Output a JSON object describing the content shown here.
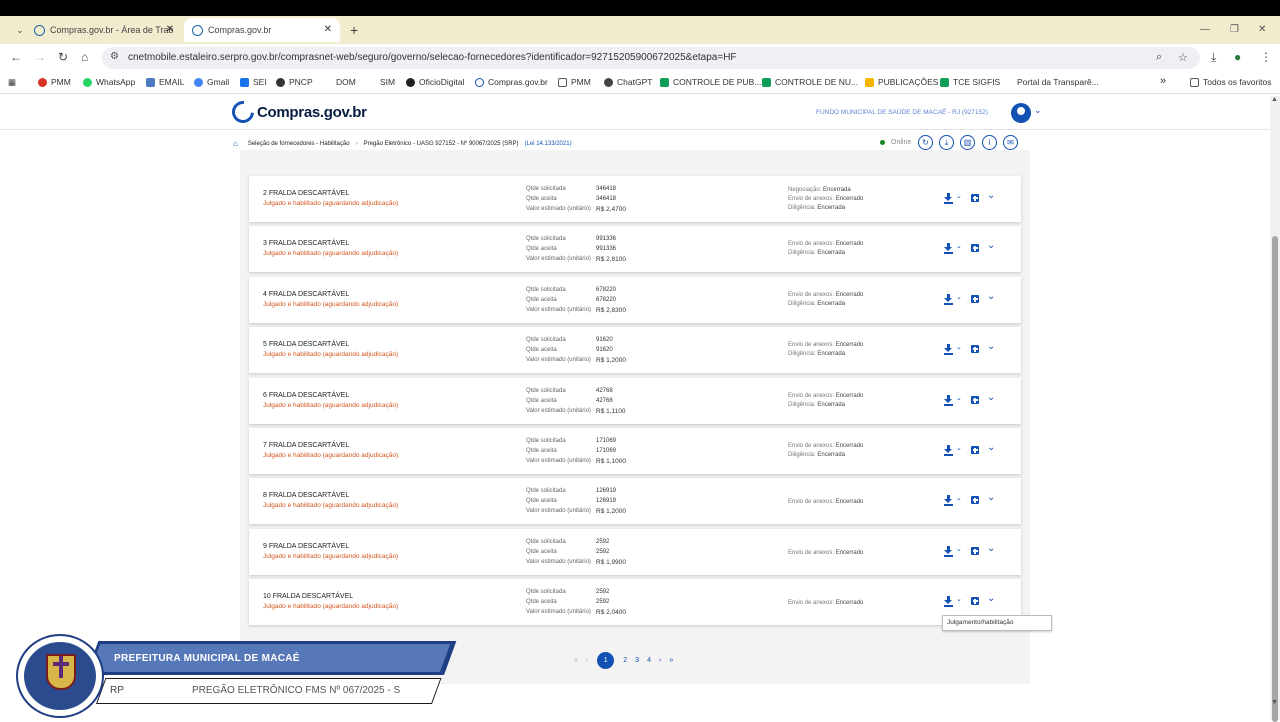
{
  "browser": {
    "tabs": [
      {
        "label": "Compras.gov.br - Área de Trab"
      },
      {
        "label": "Compras.gov.br"
      }
    ],
    "new_tab": "+",
    "url": "cnetmobile.estaleiro.serpro.gov.br/comprasnet-web/seguro/governo/selecao-fornecedores?identificador=92715205900672025&etapa=HF",
    "bookmarks": [
      {
        "label": "PMM",
        "color": "#d93025"
      },
      {
        "label": "WhatsApp",
        "color": "#25d366"
      },
      {
        "label": "EMAIL",
        "color": "#4a7ac0"
      },
      {
        "label": "Gmail",
        "color": "#4285f4"
      },
      {
        "label": "SEI",
        "color": "#1a73e8"
      },
      {
        "label": "PNCP",
        "color": "#333333"
      },
      {
        "label": "DOM",
        "color": "#ffffff"
      },
      {
        "label": "SIM",
        "color": "#ffffff"
      },
      {
        "label": "OficioDigital",
        "color": "#222222"
      },
      {
        "label": "Compras.gov.br",
        "color": "#1351b4"
      },
      {
        "label": "PMM",
        "color": "#555555"
      },
      {
        "label": "ChatGPT",
        "color": "#444444"
      },
      {
        "label": "CONTROLE DE PUB...",
        "color": "#0f9d58"
      },
      {
        "label": "CONTROLE DE NU...",
        "color": "#0f9d58"
      },
      {
        "label": "PUBLICAÇÕES",
        "color": "#f4b400"
      },
      {
        "label": "TCE SIGFIS",
        "color": "#0f9d58"
      },
      {
        "label": "Portal da Transparê...",
        "color": "#ffffff"
      }
    ],
    "more_bookmarks": "»",
    "all_favorites": "Todos os favoritos"
  },
  "header": {
    "logo_text": "Compras.gov.br",
    "org": "FUNDO MUNICIPAL DE SAÚDE DE MACAÉ - RJ (927152)"
  },
  "breadcrumb": {
    "items": [
      "Seleção de fornecedores - Habilitação",
      "Pregão Eletrônico - UASG 927152 - Nº 90067/2025 (SRP)"
    ],
    "lei": "(Lei 14.133/2021)"
  },
  "status": {
    "online": "Online"
  },
  "labels": {
    "qtde_solicitada": "Qtde solicitada",
    "qtde_aceita": "Qtde aceita",
    "valor_estimado": "Valor estimado (unitário)",
    "negociacao": "Negociação:",
    "envio_anexos": "Envio de anexos:",
    "diligencia": "Diligência:"
  },
  "items": [
    {
      "title": "2  FRALDA DESCARTÁVEL",
      "status": "Julgado e habilitado (aguardando adjudicação)",
      "qtde_solicitada": "346418",
      "qtde_aceita": "346418",
      "valor": "R$ 2,4700",
      "negociacao": "Encerrada",
      "envio": "Encerrado",
      "diligencia": "Encerrada"
    },
    {
      "title": "3  FRALDA DESCARTÁVEL",
      "status": "Julgado e habilitado (aguardando adjudicação)",
      "qtde_solicitada": "991336",
      "qtde_aceita": "991336",
      "valor": "R$ 2,8100",
      "negociacao": "",
      "envio": "Encerrado",
      "diligencia": "Encerrada"
    },
    {
      "title": "4  FRALDA DESCARTÁVEL",
      "status": "Julgado e habilitado (aguardando adjudicação)",
      "qtde_solicitada": "678220",
      "qtde_aceita": "678220",
      "valor": "R$ 2,8300",
      "negociacao": "",
      "envio": "Encerrado",
      "diligencia": "Encerrada"
    },
    {
      "title": "5  FRALDA DESCARTÁVEL",
      "status": "Julgado e habilitado (aguardando adjudicação)",
      "qtde_solicitada": "91620",
      "qtde_aceita": "91620",
      "valor": "R$ 1,2000",
      "negociacao": "",
      "envio": "Encerrado",
      "diligencia": "Encerrada"
    },
    {
      "title": "6  FRALDA DESCARTÁVEL",
      "status": "Julgado e habilitado (aguardando adjudicação)",
      "qtde_solicitada": "42768",
      "qtde_aceita": "42768",
      "valor": "R$ 1,1100",
      "negociacao": "",
      "envio": "Encerrado",
      "diligencia": "Encerrada"
    },
    {
      "title": "7  FRALDA DESCARTÁVEL",
      "status": "Julgado e habilitado (aguardando adjudicação)",
      "qtde_solicitada": "171069",
      "qtde_aceita": "171069",
      "valor": "R$ 1,1000",
      "negociacao": "",
      "envio": "Encerrado",
      "diligencia": "Encerrada"
    },
    {
      "title": "8  FRALDA DESCARTÁVEL",
      "status": "Julgado e habilitado (aguardando adjudicação)",
      "qtde_solicitada": "126919",
      "qtde_aceita": "126919",
      "valor": "R$ 1,2000",
      "negociacao": "",
      "envio": "Encerrado",
      "diligencia": ""
    },
    {
      "title": "9  FRALDA DESCARTÁVEL",
      "status": "Julgado e habilitado (aguardando adjudicação)",
      "qtde_solicitada": "2592",
      "qtde_aceita": "2592",
      "valor": "R$ 1,9900",
      "negociacao": "",
      "envio": "Encerrado",
      "diligencia": ""
    },
    {
      "title": "10  FRALDA DESCARTÁVEL",
      "status": "Julgado e habilitado (aguardando adjudicação)",
      "qtde_solicitada": "2592",
      "qtde_aceita": "2592",
      "valor": "R$ 2,0400",
      "negociacao": "",
      "envio": "Encerrado",
      "diligencia": ""
    }
  ],
  "tooltip": "Julgamento/habilitação",
  "pagination": {
    "first": "«",
    "prev": "‹",
    "pages": [
      "1",
      "2",
      "3",
      "4"
    ],
    "current": "1",
    "next": "›",
    "last": "»"
  },
  "overlay": {
    "banner": "PREFEITURA MUNICIPAL DE MACAÉ",
    "lower_left": "RP",
    "lower_right": "PREGÃO ELETRÔNICO FMS Nº 067/2025 - S"
  }
}
